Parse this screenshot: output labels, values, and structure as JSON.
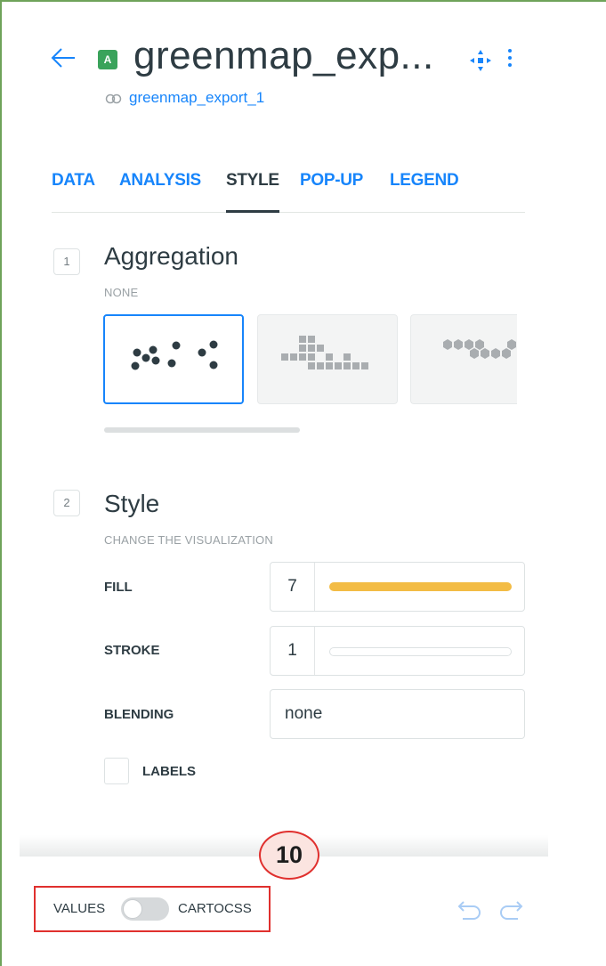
{
  "header": {
    "badge": "A",
    "title": "greenmap_exp...",
    "source": "greenmap_export_1"
  },
  "tabs": [
    {
      "label": "DATA"
    },
    {
      "label": "ANALYSIS"
    },
    {
      "label": "STYLE"
    },
    {
      "label": "POP-UP"
    },
    {
      "label": "LEGEND"
    }
  ],
  "active_tab": "STYLE",
  "aggregation": {
    "number": "1",
    "title": "Aggregation",
    "value": "NONE",
    "options": [
      "points",
      "squares",
      "hexabins"
    ],
    "selected": "points"
  },
  "style": {
    "number": "2",
    "title": "Style",
    "subtitle": "CHANGE THE VISUALIZATION",
    "fill": {
      "label": "FILL",
      "value": "7",
      "color": "#f3bc45"
    },
    "stroke": {
      "label": "STROKE",
      "value": "1"
    },
    "blending": {
      "label": "BLENDING",
      "value": "none"
    },
    "labels": {
      "label": "LABELS",
      "checked": false
    }
  },
  "footer": {
    "left_label": "VALUES",
    "right_label": "CARTOCSS",
    "toggle_on": false
  },
  "annotation": {
    "step": "10",
    "color": "#e0302e"
  },
  "colors": {
    "accent": "#1785fb",
    "badge": "#3aa35b",
    "text": "#2e3c43"
  }
}
